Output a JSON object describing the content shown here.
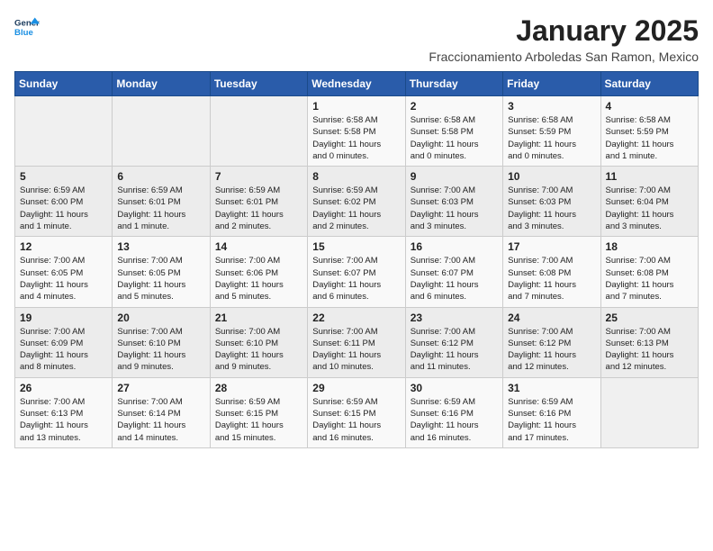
{
  "header": {
    "logo_line1": "General",
    "logo_line2": "Blue",
    "month": "January 2025",
    "subtitle": "Fraccionamiento Arboledas San Ramon, Mexico"
  },
  "weekdays": [
    "Sunday",
    "Monday",
    "Tuesday",
    "Wednesday",
    "Thursday",
    "Friday",
    "Saturday"
  ],
  "weeks": [
    [
      {
        "day": "",
        "info": ""
      },
      {
        "day": "",
        "info": ""
      },
      {
        "day": "",
        "info": ""
      },
      {
        "day": "1",
        "info": "Sunrise: 6:58 AM\nSunset: 5:58 PM\nDaylight: 11 hours\nand 0 minutes."
      },
      {
        "day": "2",
        "info": "Sunrise: 6:58 AM\nSunset: 5:58 PM\nDaylight: 11 hours\nand 0 minutes."
      },
      {
        "day": "3",
        "info": "Sunrise: 6:58 AM\nSunset: 5:59 PM\nDaylight: 11 hours\nand 0 minutes."
      },
      {
        "day": "4",
        "info": "Sunrise: 6:58 AM\nSunset: 5:59 PM\nDaylight: 11 hours\nand 1 minute."
      }
    ],
    [
      {
        "day": "5",
        "info": "Sunrise: 6:59 AM\nSunset: 6:00 PM\nDaylight: 11 hours\nand 1 minute."
      },
      {
        "day": "6",
        "info": "Sunrise: 6:59 AM\nSunset: 6:01 PM\nDaylight: 11 hours\nand 1 minute."
      },
      {
        "day": "7",
        "info": "Sunrise: 6:59 AM\nSunset: 6:01 PM\nDaylight: 11 hours\nand 2 minutes."
      },
      {
        "day": "8",
        "info": "Sunrise: 6:59 AM\nSunset: 6:02 PM\nDaylight: 11 hours\nand 2 minutes."
      },
      {
        "day": "9",
        "info": "Sunrise: 7:00 AM\nSunset: 6:03 PM\nDaylight: 11 hours\nand 3 minutes."
      },
      {
        "day": "10",
        "info": "Sunrise: 7:00 AM\nSunset: 6:03 PM\nDaylight: 11 hours\nand 3 minutes."
      },
      {
        "day": "11",
        "info": "Sunrise: 7:00 AM\nSunset: 6:04 PM\nDaylight: 11 hours\nand 3 minutes."
      }
    ],
    [
      {
        "day": "12",
        "info": "Sunrise: 7:00 AM\nSunset: 6:05 PM\nDaylight: 11 hours\nand 4 minutes."
      },
      {
        "day": "13",
        "info": "Sunrise: 7:00 AM\nSunset: 6:05 PM\nDaylight: 11 hours\nand 5 minutes."
      },
      {
        "day": "14",
        "info": "Sunrise: 7:00 AM\nSunset: 6:06 PM\nDaylight: 11 hours\nand 5 minutes."
      },
      {
        "day": "15",
        "info": "Sunrise: 7:00 AM\nSunset: 6:07 PM\nDaylight: 11 hours\nand 6 minutes."
      },
      {
        "day": "16",
        "info": "Sunrise: 7:00 AM\nSunset: 6:07 PM\nDaylight: 11 hours\nand 6 minutes."
      },
      {
        "day": "17",
        "info": "Sunrise: 7:00 AM\nSunset: 6:08 PM\nDaylight: 11 hours\nand 7 minutes."
      },
      {
        "day": "18",
        "info": "Sunrise: 7:00 AM\nSunset: 6:08 PM\nDaylight: 11 hours\nand 7 minutes."
      }
    ],
    [
      {
        "day": "19",
        "info": "Sunrise: 7:00 AM\nSunset: 6:09 PM\nDaylight: 11 hours\nand 8 minutes."
      },
      {
        "day": "20",
        "info": "Sunrise: 7:00 AM\nSunset: 6:10 PM\nDaylight: 11 hours\nand 9 minutes."
      },
      {
        "day": "21",
        "info": "Sunrise: 7:00 AM\nSunset: 6:10 PM\nDaylight: 11 hours\nand 9 minutes."
      },
      {
        "day": "22",
        "info": "Sunrise: 7:00 AM\nSunset: 6:11 PM\nDaylight: 11 hours\nand 10 minutes."
      },
      {
        "day": "23",
        "info": "Sunrise: 7:00 AM\nSunset: 6:12 PM\nDaylight: 11 hours\nand 11 minutes."
      },
      {
        "day": "24",
        "info": "Sunrise: 7:00 AM\nSunset: 6:12 PM\nDaylight: 11 hours\nand 12 minutes."
      },
      {
        "day": "25",
        "info": "Sunrise: 7:00 AM\nSunset: 6:13 PM\nDaylight: 11 hours\nand 12 minutes."
      }
    ],
    [
      {
        "day": "26",
        "info": "Sunrise: 7:00 AM\nSunset: 6:13 PM\nDaylight: 11 hours\nand 13 minutes."
      },
      {
        "day": "27",
        "info": "Sunrise: 7:00 AM\nSunset: 6:14 PM\nDaylight: 11 hours\nand 14 minutes."
      },
      {
        "day": "28",
        "info": "Sunrise: 6:59 AM\nSunset: 6:15 PM\nDaylight: 11 hours\nand 15 minutes."
      },
      {
        "day": "29",
        "info": "Sunrise: 6:59 AM\nSunset: 6:15 PM\nDaylight: 11 hours\nand 16 minutes."
      },
      {
        "day": "30",
        "info": "Sunrise: 6:59 AM\nSunset: 6:16 PM\nDaylight: 11 hours\nand 16 minutes."
      },
      {
        "day": "31",
        "info": "Sunrise: 6:59 AM\nSunset: 6:16 PM\nDaylight: 11 hours\nand 17 minutes."
      },
      {
        "day": "",
        "info": ""
      }
    ]
  ]
}
